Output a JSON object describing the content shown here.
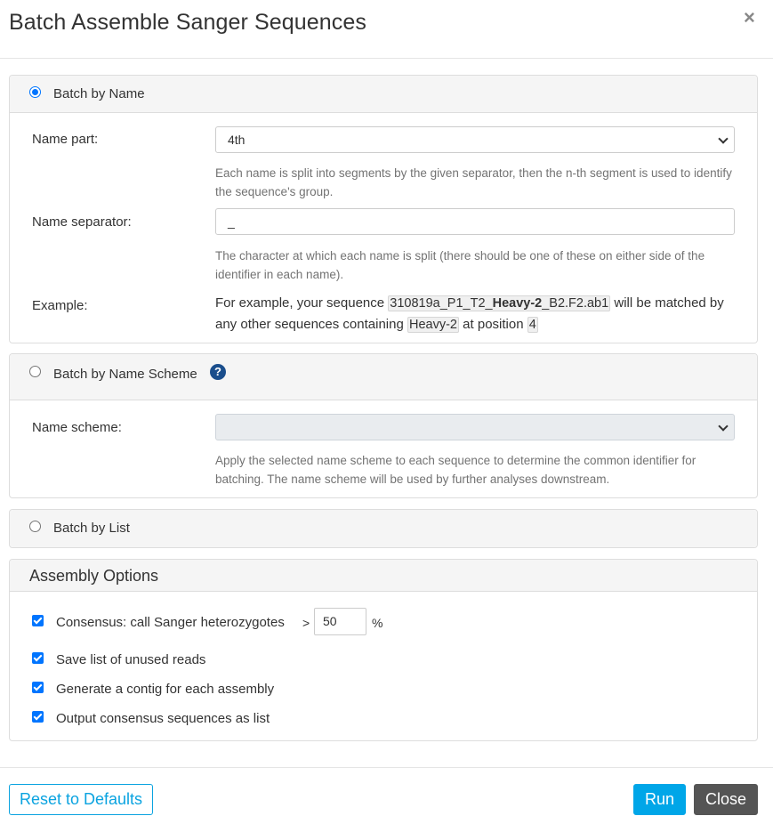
{
  "dialog": {
    "title": "Batch Assemble Sanger Sequences",
    "close_glyph": "×"
  },
  "batch_by_name": {
    "label": "Batch by Name",
    "selected": true,
    "name_part_label": "Name part:",
    "name_part_value": "4th",
    "name_part_help": "Each name is split into segments by the given separator, then the n-th segment is used to identify the sequence's group.",
    "separator_label": "Name separator:",
    "separator_value": "_",
    "separator_help": "The character at which each name is split (there should be one of these on either side of the identifier in each name).",
    "example_label": "Example:",
    "example_prefix": "For example, your sequence",
    "example_seq_start": "310819a_P1_T2_",
    "example_seq_bold": "Heavy-2",
    "example_seq_end": "_B2.F2.ab1",
    "example_middle": "will be matched by any other sequences containing",
    "example_identifier": "Heavy-2",
    "example_position_text": "at position",
    "example_position": "4"
  },
  "batch_by_scheme": {
    "label": "Batch by Name Scheme",
    "selected": false,
    "help_icon": "?",
    "scheme_label": "Name scheme:",
    "scheme_value": "",
    "scheme_help": "Apply the selected name scheme to each sequence to determine the common identifier for batching. The name scheme will be used by further analyses downstream."
  },
  "batch_by_list": {
    "label": "Batch by List",
    "selected": false
  },
  "assembly_options": {
    "title": "Assembly Options",
    "consensus_label": "Consensus: call Sanger heterozygotes",
    "consensus_gt": ">",
    "consensus_value": "50",
    "consensus_unit": "%",
    "options": [
      {
        "label": "Save list of unused reads",
        "checked": true
      },
      {
        "label": "Generate a contig for each assembly",
        "checked": true
      },
      {
        "label": "Output consensus sequences as list",
        "checked": true
      }
    ]
  },
  "footer": {
    "reset_label": "Reset to Defaults",
    "run_label": "Run",
    "close_label": "Close"
  },
  "colors": {
    "accent": "#00a6e8",
    "radio": "#0075ff",
    "close_button": "#555555"
  }
}
